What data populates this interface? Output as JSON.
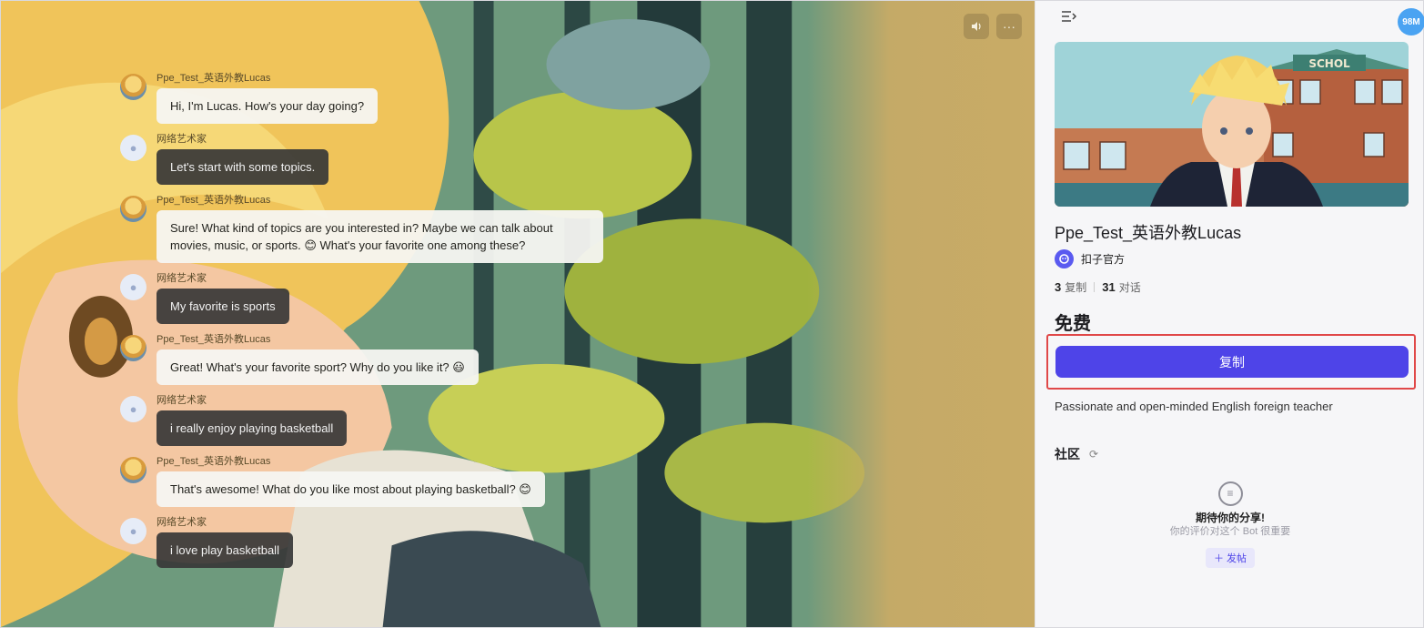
{
  "chat": {
    "tools": {
      "speaker_icon": "speaker-icon",
      "more_icon": "more-icon",
      "more_label": "···"
    },
    "messages": [
      {
        "role": "bot",
        "sender": "Ppe_Test_英语外教Lucas",
        "text": "Hi, I'm Lucas. How's your day going?"
      },
      {
        "role": "user",
        "sender": "网络艺术家",
        "text": "Let's start with some topics."
      },
      {
        "role": "bot",
        "sender": "Ppe_Test_英语外教Lucas",
        "text": "Sure! What kind of topics are you interested in? Maybe we can talk about movies, music, or sports. 😊 What's your favorite one among these?"
      },
      {
        "role": "user",
        "sender": "网络艺术家",
        "text": "My favorite is sports"
      },
      {
        "role": "bot",
        "sender": "Ppe_Test_英语外教Lucas",
        "text": "Great! What's your favorite sport? Why do you like it? 😃"
      },
      {
        "role": "user",
        "sender": "网络艺术家",
        "text": "i really enjoy playing basketball"
      },
      {
        "role": "bot",
        "sender": "Ppe_Test_英语外教Lucas",
        "text": "That's awesome! What do you like most about playing basketball? 😊"
      },
      {
        "role": "user",
        "sender": "网络艺术家",
        "text": "i love play basketball"
      }
    ]
  },
  "side": {
    "badge": "98M",
    "cover_sign": "SCHOL",
    "bot_name": "Ppe_Test_英语外教Lucas",
    "author": "扣子官方",
    "stats": {
      "copies_count": "3",
      "copies_label": "复制",
      "chats_count": "31",
      "chats_label": "对话"
    },
    "price": "免费",
    "copy_button": "复制",
    "description": "Passionate and open-minded English foreign teacher",
    "community_title": "社区",
    "empty_title": "期待你的分享!",
    "empty_subtitle": "你的评价对这个 Bot 很重要",
    "post_button": "＋ 发帖"
  },
  "colors": {
    "accent": "#4e44e8",
    "highlight": "#e04848",
    "user_bubble": "#373737",
    "bot_bubble": "#f6f5f2"
  }
}
